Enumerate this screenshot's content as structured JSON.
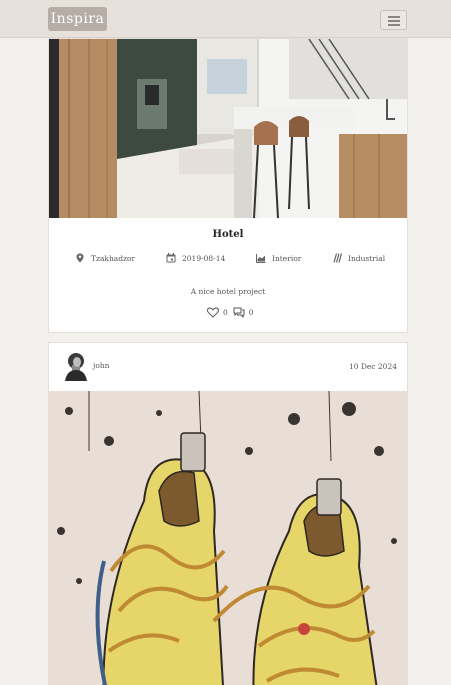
{
  "navbar": {
    "logo_text": "Inspira",
    "menu_icon": "hamburger-menu-icon"
  },
  "project_card": {
    "title": "Hotel",
    "location": "Tzakhadzor",
    "date": "2019-08-14",
    "category": "Interior",
    "style": "Industrial",
    "description": "A nice hotel project",
    "likes": "0",
    "comments": "0",
    "icons": [
      "map-pin-icon",
      "calendar-icon",
      "chart-icon",
      "style-stripes-icon",
      "heart-icon",
      "comment-icon"
    ]
  },
  "post_card": {
    "author": "john",
    "date": "10 Dec 2024"
  },
  "colors": {
    "navbar_bg": "#e7e1dc",
    "page_bg": "#f3f1ee",
    "card_bg": "#ffffff"
  }
}
